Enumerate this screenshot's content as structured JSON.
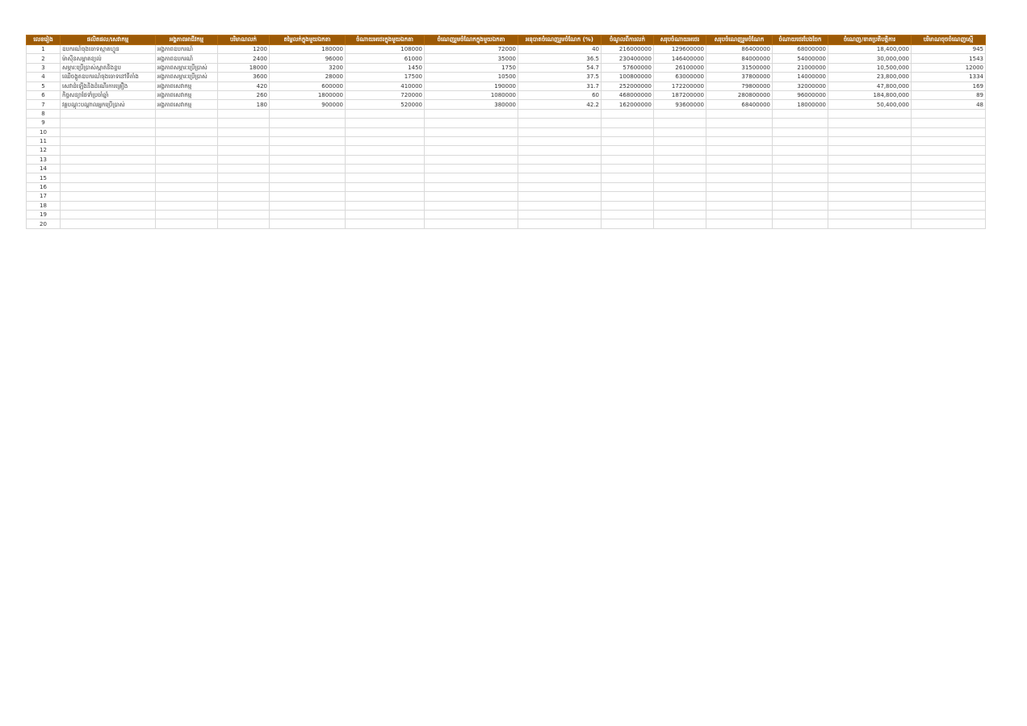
{
  "colors": {
    "header_bg": "#9c5a06",
    "header_text": "#ffffff",
    "grid_line": "#d9d9d9"
  },
  "table": {
    "headers": [
      "លេខរៀង",
      "ផលិតផល/សេវាកម្ម",
      "អង្គភាពអាជីវកម្ម",
      "បរិមាណលក់",
      "តម្លៃលក់ក្នុងមួយឯកតា",
      "ចំណាយអថេរក្នុងមួយឯកតា",
      "ចំណេញរួមចំណែកក្នុងមួយឯកតា",
      "អនុបាតចំណេញរួមចំណែក (%)",
      "ចំណូលពីការលក់",
      "សរុបចំណាយអថេរ",
      "សរុបចំណេញរួមចំណែក",
      "ចំណាយថេរបែងចែក",
      "ចំណេញ/ខាតប្រតិបត្តិការ",
      "បរិមាណចុចចំណេញស្មើ"
    ],
    "rows": [
      [
        "1",
        "ឧបករណ៍ចុងចោទស្មាតហ្វូន",
        "អង្គភាពឧបករណ៍",
        "1200",
        "180000",
        "108000",
        "72000",
        "40",
        "216000000",
        "129600000",
        "86400000",
        "68000000",
        "18,400,000",
        "945"
      ],
      [
        "2",
        "ម៉ាស៊ីនសម្អាតខ្យល់",
        "អង្គភាពឧបករណ៍",
        "2400",
        "96000",
        "61000",
        "35000",
        "36.5",
        "230400000",
        "146400000",
        "84000000",
        "54000000",
        "30,000,000",
        "1543"
      ],
      [
        "3",
        "សម្ភារៈប្រើប្រាស់ស្អាតនិងខ្ទប",
        "អង្គភាពសម្ភារៈប្រើប្រាស់",
        "18000",
        "3200",
        "1450",
        "1750",
        "54.7",
        "57600000",
        "26100000",
        "31500000",
        "21000000",
        "10,500,000",
        "12000"
      ],
      [
        "4",
        "ឈើចង្កូតឧបករណ៍ចុងចោទនៅទីតាំង",
        "អង្គភាពសម្ភារៈប្រើប្រាស់",
        "3600",
        "28000",
        "17500",
        "10500",
        "37.5",
        "100800000",
        "63000000",
        "37800000",
        "14000000",
        "23,800,000",
        "1334"
      ],
      [
        "5",
        "សេវាដំឡើងនិងដំណើរការគ្រឿង",
        "អង្គភាពសេវាកម្ម",
        "420",
        "600000",
        "410000",
        "190000",
        "31.7",
        "252000000",
        "172200000",
        "79800000",
        "32000000",
        "47,800,000",
        "169"
      ],
      [
        "6",
        "កិច្ចសន្យាថែទាំប្រចាំឆ្នាំ",
        "អង្គភាពសេវាកម្ម",
        "260",
        "1800000",
        "720000",
        "1080000",
        "60",
        "468000000",
        "187200000",
        "280800000",
        "96000000",
        "184,800,000",
        "89"
      ],
      [
        "7",
        "វគ្គបណ្តុះបណ្តាលអ្នកប្រើប្រាស់",
        "អង្គភាពសេវាកម្ម",
        "180",
        "900000",
        "520000",
        "380000",
        "42.2",
        "162000000",
        "93600000",
        "68400000",
        "18000000",
        "50,400,000",
        "48"
      ],
      [
        "8",
        "",
        "",
        "",
        "",
        "",
        "",
        "",
        "",
        "",
        "",
        "",
        "",
        ""
      ],
      [
        "9",
        "",
        "",
        "",
        "",
        "",
        "",
        "",
        "",
        "",
        "",
        "",
        "",
        ""
      ],
      [
        "10",
        "",
        "",
        "",
        "",
        "",
        "",
        "",
        "",
        "",
        "",
        "",
        "",
        ""
      ],
      [
        "11",
        "",
        "",
        "",
        "",
        "",
        "",
        "",
        "",
        "",
        "",
        "",
        "",
        ""
      ],
      [
        "12",
        "",
        "",
        "",
        "",
        "",
        "",
        "",
        "",
        "",
        "",
        "",
        "",
        ""
      ],
      [
        "13",
        "",
        "",
        "",
        "",
        "",
        "",
        "",
        "",
        "",
        "",
        "",
        "",
        ""
      ],
      [
        "14",
        "",
        "",
        "",
        "",
        "",
        "",
        "",
        "",
        "",
        "",
        "",
        "",
        ""
      ],
      [
        "15",
        "",
        "",
        "",
        "",
        "",
        "",
        "",
        "",
        "",
        "",
        "",
        "",
        ""
      ],
      [
        "16",
        "",
        "",
        "",
        "",
        "",
        "",
        "",
        "",
        "",
        "",
        "",
        "",
        ""
      ],
      [
        "17",
        "",
        "",
        "",
        "",
        "",
        "",
        "",
        "",
        "",
        "",
        "",
        "",
        ""
      ],
      [
        "18",
        "",
        "",
        "",
        "",
        "",
        "",
        "",
        "",
        "",
        "",
        "",
        "",
        ""
      ],
      [
        "19",
        "",
        "",
        "",
        "",
        "",
        "",
        "",
        "",
        "",
        "",
        "",
        "",
        ""
      ],
      [
        "20",
        "",
        "",
        "",
        "",
        "",
        "",
        "",
        "",
        "",
        "",
        "",
        "",
        ""
      ]
    ]
  }
}
